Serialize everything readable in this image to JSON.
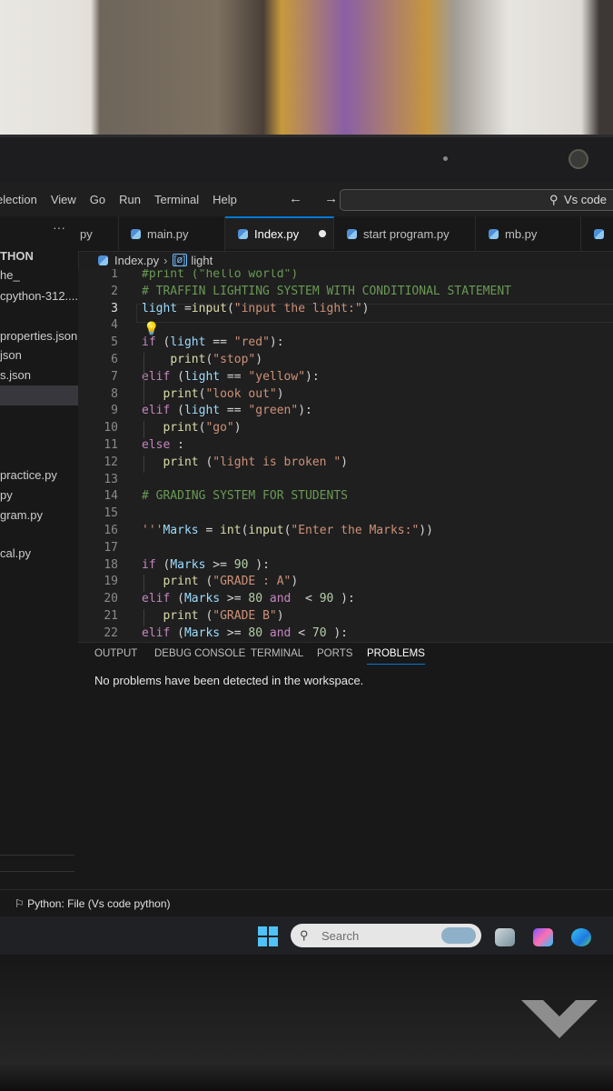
{
  "menu": [
    "election",
    "View",
    "Go",
    "Run",
    "Terminal",
    "Help"
  ],
  "nav_arrows": "← →",
  "command_center": "Vs code",
  "sidebar": {
    "section_title": "THON",
    "more": "···",
    "items": [
      "he_",
      "cpython-312....",
      "properties.json",
      "json",
      "s.json",
      "practice.py",
      "py",
      "gram.py",
      "cal.py"
    ]
  },
  "tabs": [
    {
      "label": "py"
    },
    {
      "label": "main.py"
    },
    {
      "label": "Index.py",
      "active": true,
      "modified": true
    },
    {
      "label": "start program.py"
    },
    {
      "label": "mb.py"
    }
  ],
  "breadcrumb": {
    "file": "Index.py",
    "symbol": "light"
  },
  "code_lines": [
    {
      "n": "1",
      "t": "#print (\"hello world\")"
    },
    {
      "n": "2",
      "t": "# TRAFFIN LIGHTING SYSTEM WITH CONDITIONAL STATEMENT"
    },
    {
      "n": "3",
      "t": "light =input(\"input the light:\")"
    },
    {
      "n": "4",
      "t": ""
    },
    {
      "n": "5",
      "t": "if (light == \"red\"):"
    },
    {
      "n": "6",
      "t": "    print(\"stop\")"
    },
    {
      "n": "7",
      "t": "elif (light == \"yellow\"):"
    },
    {
      "n": "8",
      "t": "   print(\"look out\")"
    },
    {
      "n": "9",
      "t": "elif (light == \"green\"):"
    },
    {
      "n": "10",
      "t": "   print(\"go\")"
    },
    {
      "n": "11",
      "t": "else :"
    },
    {
      "n": "12",
      "t": "   print (\"light is broken \")"
    },
    {
      "n": "13",
      "t": ""
    },
    {
      "n": "14",
      "t": "# GRADING SYSTEM FOR STUDENTS"
    },
    {
      "n": "15",
      "t": ""
    },
    {
      "n": "16",
      "t": "'''Marks = int(input(\"Enter the Marks:\"))"
    },
    {
      "n": "17",
      "t": ""
    },
    {
      "n": "18",
      "t": "if (Marks >= 90 ):"
    },
    {
      "n": "19",
      "t": "   print (\"GRADE : A\")"
    },
    {
      "n": "20",
      "t": "elif (Marks >= 80 and  < 90 ):"
    },
    {
      "n": "21",
      "t": "   print (\"GRADE B\")"
    },
    {
      "n": "22",
      "t": "elif (Marks >= 80 and < 70 ):"
    }
  ],
  "panel": {
    "tabs": [
      "OUTPUT",
      "DEBUG CONSOLE",
      "TERMINAL",
      "PORTS",
      "PROBLEMS"
    ],
    "active_tab": "PROBLEMS",
    "message": "No problems have been detected in the workspace."
  },
  "status_bar": {
    "interpreter": "Python: File (Vs code python)"
  },
  "taskbar": {
    "search_placeholder": "Search"
  }
}
